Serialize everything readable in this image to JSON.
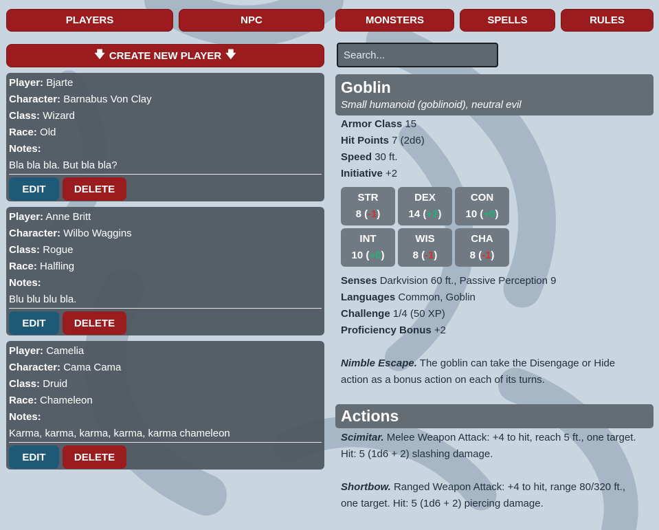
{
  "nav": {
    "players": "PLAYERS",
    "npc": "NPC",
    "monsters": "MONSTERS",
    "spells": "SPELLS",
    "rules": "RULES"
  },
  "create_button": "CREATE NEW PLAYER",
  "search": {
    "placeholder": "Search..."
  },
  "labels": {
    "player": "Player:",
    "character": "Character:",
    "class": "Class:",
    "race": "Race:",
    "notes": "Notes:",
    "edit": "EDIT",
    "delete": "DELETE"
  },
  "players": [
    {
      "player": "Bjarte",
      "character": "Barnabus Von Clay",
      "class": "Wizard",
      "race": "Old",
      "notes": "Bla bla bla. But bla bla?"
    },
    {
      "player": "Anne Britt",
      "character": "Wilbo Waggins",
      "class": "Rogue",
      "race": "Halfling",
      "notes": "Blu blu blu bla."
    },
    {
      "player": "Camelia",
      "character": "Cama Cama",
      "class": "Druid",
      "race": "Chameleon",
      "notes": "Karma, karma, karma, karma, karma chameleon"
    }
  ],
  "monster": {
    "name": "Goblin",
    "subtitle": "Small humanoid (goblinoid), neutral evil",
    "armor_class_label": "Armor Class",
    "armor_class": "15",
    "hit_points_label": "Hit Points",
    "hit_points": "7 (2d6)",
    "speed_label": "Speed",
    "speed": "30 ft.",
    "initiative_label": "Initiative",
    "initiative": "+2",
    "abilities": [
      {
        "abbr": "STR",
        "score": "8",
        "mod": "-1",
        "sign": "neg"
      },
      {
        "abbr": "DEX",
        "score": "14",
        "mod": "+2",
        "sign": "pos"
      },
      {
        "abbr": "CON",
        "score": "10",
        "mod": "+0",
        "sign": "pos"
      },
      {
        "abbr": "INT",
        "score": "10",
        "mod": "+0",
        "sign": "pos"
      },
      {
        "abbr": "WIS",
        "score": "8",
        "mod": "-1",
        "sign": "neg"
      },
      {
        "abbr": "CHA",
        "score": "8",
        "mod": "-1",
        "sign": "neg"
      }
    ],
    "senses_label": "Senses",
    "senses": "Darkvision 60 ft., Passive Perception 9",
    "languages_label": "Languages",
    "languages": "Common, Goblin",
    "challenge_label": "Challenge",
    "challenge": "1/4 (50 XP)",
    "proficiency_label": "Proficiency Bonus",
    "proficiency": "+2",
    "trait_name": "Nimble Escape.",
    "trait_text": "The goblin can take the Disengage or Hide action as a bonus action on each of its turns.",
    "actions_title": "Actions",
    "actions": [
      {
        "name": "Scimitar.",
        "text": "Melee Weapon Attack: +4 to hit, reach 5 ft., one target. Hit: 5 (1d6 + 2) slashing damage."
      },
      {
        "name": "Shortbow.",
        "text": "Ranged Weapon Attack: +4 to hit, range 80/320 ft., one target. Hit: 5 (1d6 + 2) piercing damage."
      }
    ]
  },
  "colors": {
    "background": "#c9d6e0",
    "button_red": "#9b1c1f",
    "edit_blue": "#1e5a78",
    "card": "#4e565f",
    "negative": "#d6302d",
    "positive": "#22b07a"
  }
}
